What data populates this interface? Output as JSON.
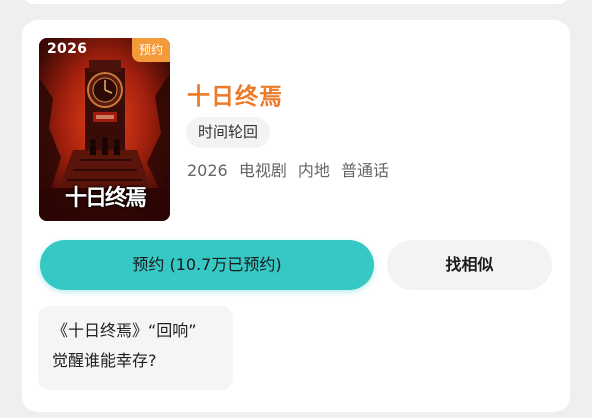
{
  "poster": {
    "year": "2026",
    "badge": "预约",
    "title_art": "十日终焉"
  },
  "title": "十日终焉",
  "tag": "时间轮回",
  "meta": {
    "year": "2026",
    "type": "电视剧",
    "region": "内地",
    "language": "普通话"
  },
  "buttons": {
    "reserve": "预约 (10.7万已预约)",
    "similar": "找相似"
  },
  "news": {
    "line1": "《十日终焉》“回响”",
    "line2": "觉醒谁能幸存?"
  },
  "colors": {
    "accent": "#35c8c4",
    "title": "#ec7a28",
    "badge": "#f39a3b"
  },
  "icons": {
    "poster_image": "poster-image"
  }
}
